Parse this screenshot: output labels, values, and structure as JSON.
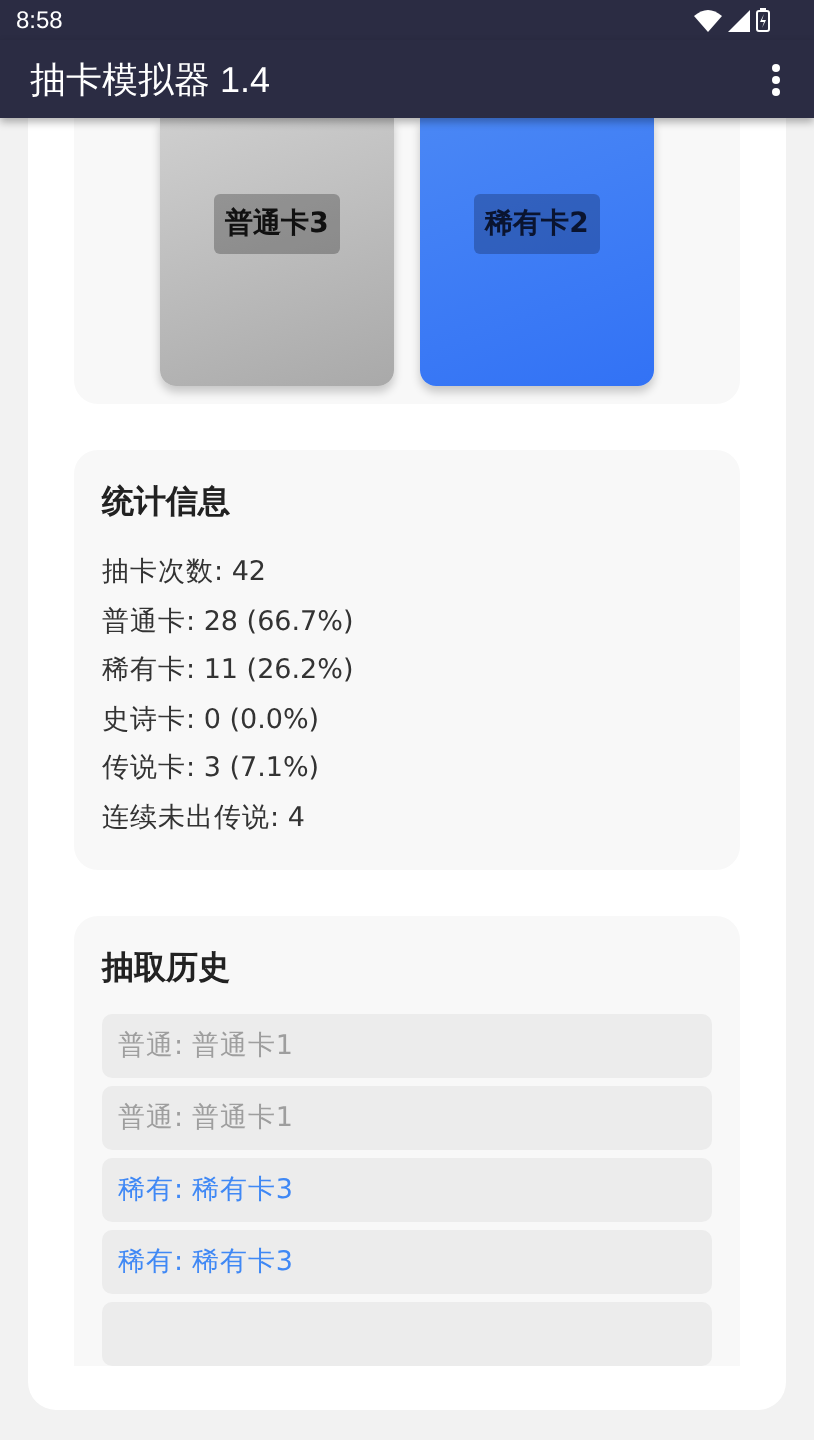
{
  "status_bar": {
    "time": "8:58"
  },
  "app_bar": {
    "title": "抽卡模拟器 1.4"
  },
  "drawn_cards": [
    {
      "kind": "common",
      "name": "普通卡3"
    },
    {
      "kind": "rare",
      "name": "稀有卡2"
    }
  ],
  "stats": {
    "title": "统计信息",
    "lines": [
      "抽卡次数: 42",
      "普通卡: 28 (66.7%)",
      "稀有卡: 11 (26.2%)",
      "史诗卡: 0 (0.0%)",
      "传说卡: 3 (7.1%)",
      "连续未出传说: 4"
    ]
  },
  "history": {
    "title": "抽取历史",
    "items": [
      {
        "kind": "common",
        "text": "普通: 普通卡1"
      },
      {
        "kind": "common",
        "text": "普通: 普通卡1"
      },
      {
        "kind": "rare",
        "text": "稀有: 稀有卡3"
      },
      {
        "kind": "rare",
        "text": "稀有: 稀有卡3"
      }
    ]
  }
}
